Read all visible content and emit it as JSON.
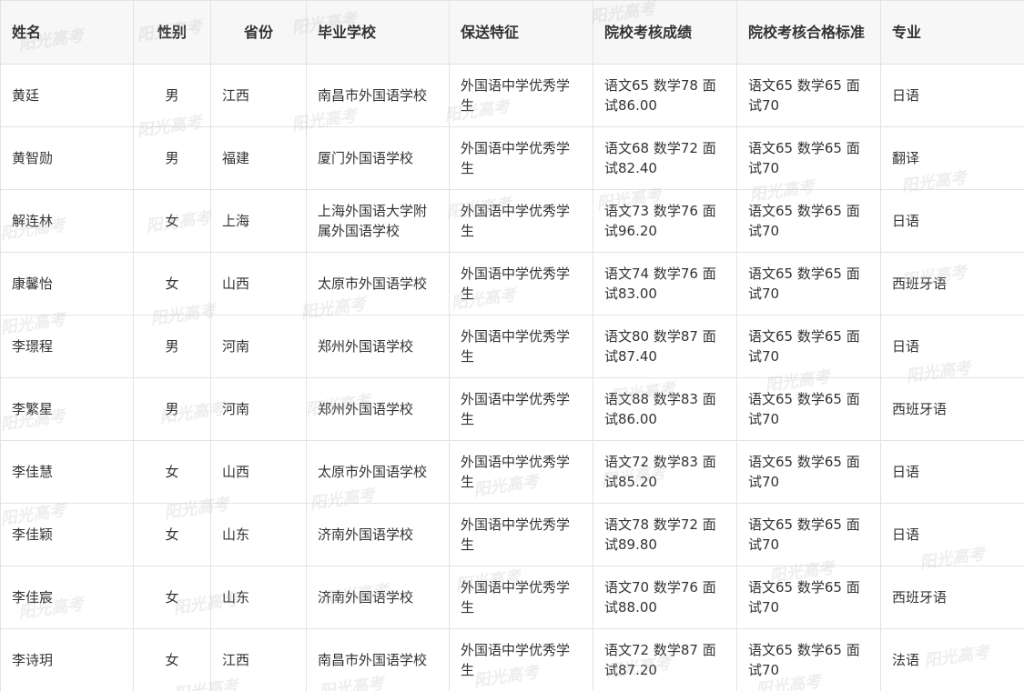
{
  "table": {
    "headers": [
      "姓名",
      "性别",
      "省份",
      "毕业学校",
      "保送特征",
      "院校考核成绩",
      "院校考核合格标准",
      "专业"
    ],
    "rows": [
      [
        "黄廷",
        "男",
        "江西",
        "南昌市外国语学校",
        "外国语中学优秀学生",
        "语文65 数学78 面试86.00",
        "语文65 数学65 面试70",
        "日语"
      ],
      [
        "黄智勋",
        "男",
        "福建",
        "厦门外国语学校",
        "外国语中学优秀学生",
        "语文68 数学72 面试82.40",
        "语文65 数学65 面试70",
        "翻译"
      ],
      [
        "解连林",
        "女",
        "上海",
        "上海外国语大学附属外国语学校",
        "外国语中学优秀学生",
        "语文73 数学76 面试96.20",
        "语文65 数学65 面试70",
        "日语"
      ],
      [
        "康馨怡",
        "女",
        "山西",
        "太原市外国语学校",
        "外国语中学优秀学生",
        "语文74 数学76 面试83.00",
        "语文65 数学65 面试70",
        "西班牙语"
      ],
      [
        "李璟程",
        "男",
        "河南",
        "郑州外国语学校",
        "外国语中学优秀学生",
        "语文80 数学87 面试87.40",
        "语文65 数学65 面试70",
        "日语"
      ],
      [
        "李繁星",
        "男",
        "河南",
        "郑州外国语学校",
        "外国语中学优秀学生",
        "语文88 数学83 面试86.00",
        "语文65 数学65 面试70",
        "西班牙语"
      ],
      [
        "李佳慧",
        "女",
        "山西",
        "太原市外国语学校",
        "外国语中学优秀学生",
        "语文72 数学83 面试85.20",
        "语文65 数学65 面试70",
        "日语"
      ],
      [
        "李佳颖",
        "女",
        "山东",
        "济南外国语学校",
        "外国语中学优秀学生",
        "语文78 数学72 面试89.80",
        "语文65 数学65 面试70",
        "日语"
      ],
      [
        "李佳宸",
        "女",
        "山东",
        "济南外国语学校",
        "外国语中学优秀学生",
        "语文70 数学76 面试88.00",
        "语文65 数学65 面试70",
        "西班牙语"
      ],
      [
        "李诗玥",
        "女",
        "江西",
        "南昌市外国语学校",
        "外国语中学优秀学生",
        "语文72 数学87 面试87.20",
        "语文65 数学65 面试70",
        "法语"
      ]
    ]
  },
  "watermark": {
    "text": "阳光高考"
  }
}
